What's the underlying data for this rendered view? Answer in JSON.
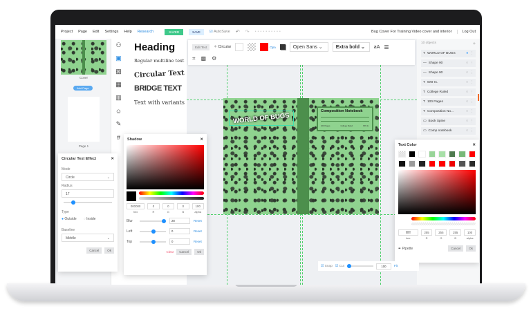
{
  "menu": {
    "items": [
      "Project",
      "Page",
      "Edit",
      "Settings",
      "Help"
    ],
    "research": "Research",
    "saved": "SAVED",
    "save": "SAVE",
    "autosave": "AutoSave",
    "title": "Bug Cover For Training Video cover and interior",
    "logout": "Log Out"
  },
  "pages": {
    "cover_label": "Cover",
    "add_page": "Add Page",
    "page1_label": "Page 1"
  },
  "elements": {
    "heading": "Heading",
    "multiline": "Regular multiline text",
    "circular": "Circular Text",
    "bridge": "BRIDGE TEXT",
    "variants": "Text with variants"
  },
  "toolbar": {
    "edit_text": "Edit Text",
    "circular": "Circular",
    "opacity": "Opa",
    "font": "Open Sans",
    "weight": "Extra bold",
    "case": "aA"
  },
  "objects": {
    "count": "10 objects",
    "items": [
      {
        "icon": "T",
        "label": "WORLD OF BUGS"
      },
      {
        "icon": "—",
        "label": "Shape 90"
      },
      {
        "icon": "—",
        "label": "Shape 90"
      },
      {
        "icon": "T",
        "label": "6X9 In."
      },
      {
        "icon": "T",
        "label": "College Ruled"
      },
      {
        "icon": "T",
        "label": "100 Pages"
      },
      {
        "icon": "T",
        "label": "Composition No..."
      },
      {
        "icon": "▭",
        "label": "Book Spine"
      },
      {
        "icon": "▭",
        "label": "Comp notebook"
      }
    ]
  },
  "book": {
    "title_text": "WORLD OF BUGS",
    "notebook_title": "Composition Notebook",
    "foot": [
      "100 Pages",
      "College Ruled",
      "6X9 In."
    ],
    "green": "#8fd38f",
    "spine": "#4c8f4c"
  },
  "circular_panel": {
    "title": "Circular Text Effect",
    "mode_label": "Mode",
    "mode": "Circle",
    "radius_label": "Radius",
    "radius": "17",
    "radius_fraction": 0.15,
    "type_label": "Type",
    "outside": "Outside",
    "inside": "Inside",
    "baseline_label": "Baseline",
    "baseline": "Middle",
    "cancel": "Cancel",
    "ok": "Ok"
  },
  "shadow_panel": {
    "title": "Shadow",
    "hex": "000000",
    "r": "0",
    "g": "0",
    "b": "0",
    "alpha": "100",
    "caps": [
      "hex",
      "R",
      "G",
      "B",
      "alpha"
    ],
    "blur_label": "Blur",
    "blur": "28",
    "left_label": "Left",
    "left": "0",
    "top_label": "Top",
    "top": "0",
    "reset": "Reset",
    "clear": "Clear",
    "cancel": "Cancel",
    "ok": "Ok"
  },
  "text_color_panel": {
    "title": "Text Color",
    "swatches": [
      "#ffffff00",
      "#000000",
      "#ffffff",
      "#98d498",
      "#a8e0a8",
      "#4e7a4e",
      "#78b878",
      "#ff0000",
      "#111111",
      "#9a9a9a",
      "#222222",
      "#ff0000",
      "#ff0000",
      "#ee0000",
      "#555555",
      "#2a2a2a"
    ],
    "hex": "ffffff",
    "r": "255",
    "g": "255",
    "b": "255",
    "alpha": "100",
    "caps": [
      "hex",
      "R",
      "G",
      "B",
      "alpha"
    ],
    "pipette": "Pipette",
    "cancel": "Cancel",
    "ok": "Ok"
  },
  "bottombar": {
    "snap": "Snap",
    "cut": "Cut",
    "zoom": "100",
    "fit": "Fit"
  }
}
